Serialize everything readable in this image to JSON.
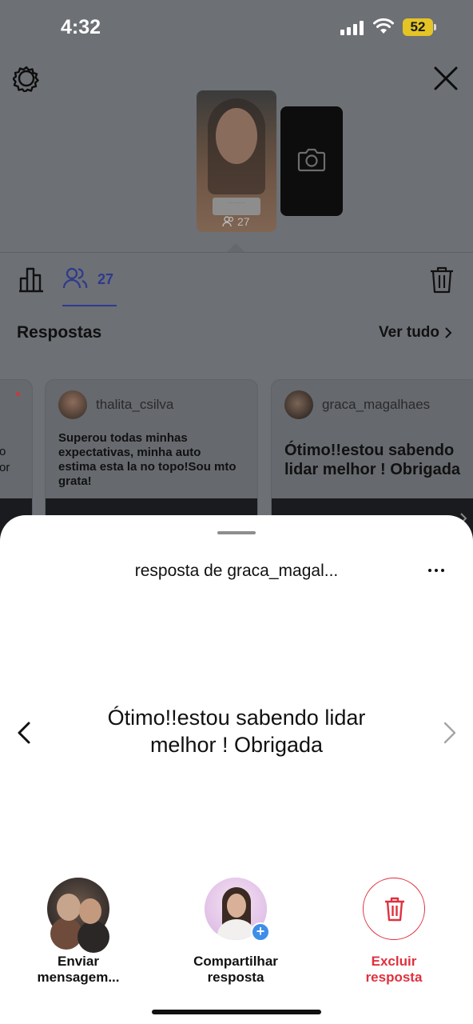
{
  "status_bar": {
    "time": "4:32",
    "battery": "52"
  },
  "story": {
    "viewers_count": "27"
  },
  "tabs": {
    "viewers_count": "27"
  },
  "answers_section": {
    "title": "Respostas",
    "see_all": "Ver tudo"
  },
  "cards": [
    {
      "username": "thalita_csilva",
      "text": "Superou todas minhas expectativas, minha auto estima esta la no topo!Sou mto grata!"
    },
    {
      "username": "graca_magalhaes",
      "text": "Ótimo!!estou sabendo lidar melhor ! Obrigada"
    }
  ],
  "sheet": {
    "title": "resposta de graca_magal...",
    "answer": "Ótimo!!estou sabendo lidar melhor ! Obrigada",
    "actions": {
      "message_line1": "Enviar",
      "message_line2": "mensagem...",
      "share_line1": "Compartilhar",
      "share_line2": "resposta",
      "delete_line1": "Excluir",
      "delete_line2": "resposta"
    }
  },
  "colors": {
    "accent_blue": "#2e3a8c",
    "delete_red": "#e0303f",
    "badge_blue": "#3f8ee8",
    "battery_yellow": "#e5c425"
  },
  "icons": [
    "gear-icon",
    "close-icon",
    "camera-icon",
    "bar-chart-icon",
    "people-icon",
    "trash-icon",
    "chevron-right-icon",
    "chevron-left-icon",
    "more-icon",
    "plus-icon"
  ]
}
